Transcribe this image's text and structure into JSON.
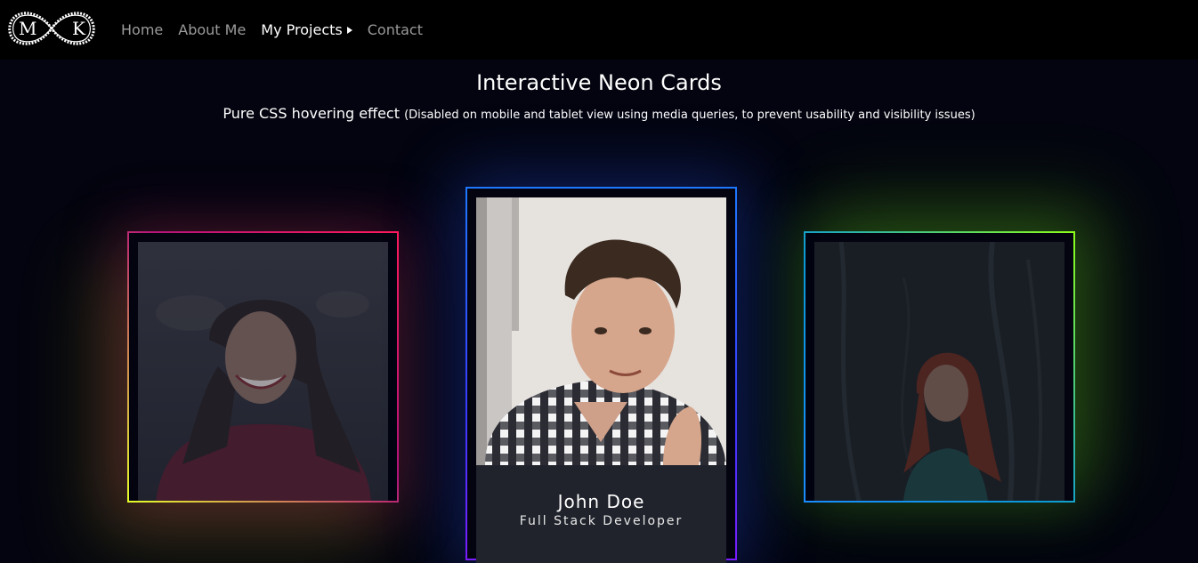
{
  "logo": {
    "left_letter": "M",
    "right_letter": "K"
  },
  "nav": {
    "items": [
      {
        "label": "Home"
      },
      {
        "label": "About Me"
      },
      {
        "label": "My Projects"
      },
      {
        "label": "Contact"
      }
    ]
  },
  "page": {
    "title": "Interactive Neon Cards",
    "subtitle": "Pure CSS hovering effect",
    "subtitle_note": "(Disabled on mobile and tablet view using media queries, to prevent usability and visibility issues)"
  },
  "cards": [
    {
      "border_colors": [
        "#e7ff2a",
        "#b6137a",
        "#ff1a5b"
      ]
    },
    {
      "name": "John Doe",
      "role": "Full Stack Developer",
      "border_colors": [
        "#7a1cff",
        "#3a3bff",
        "#1e78ff"
      ]
    },
    {
      "border_colors": [
        "#8cff1a",
        "#0b9ad8",
        "#1a8cff"
      ]
    }
  ]
}
